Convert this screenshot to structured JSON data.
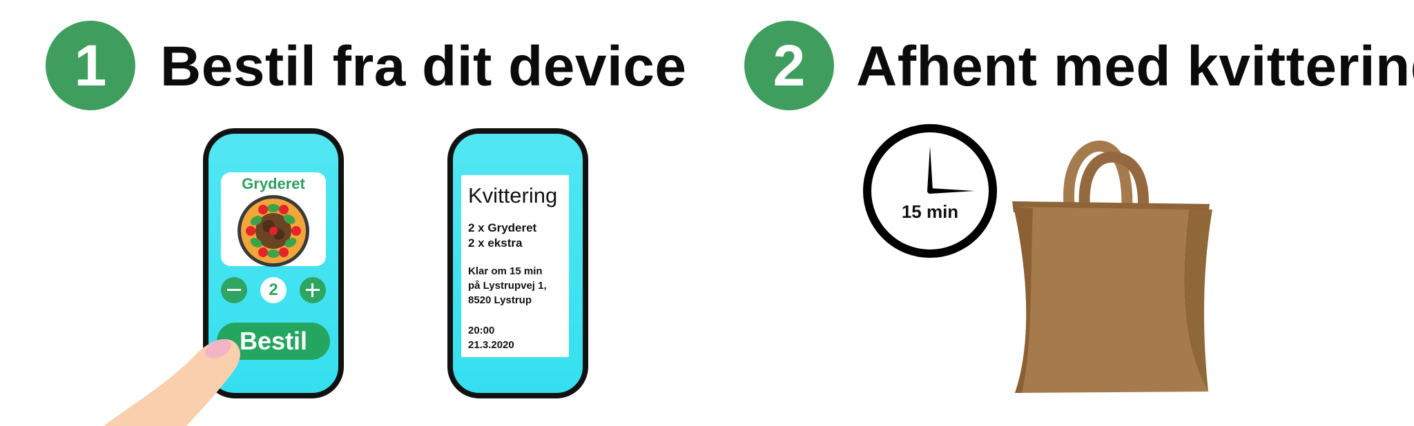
{
  "steps": [
    {
      "number": "1",
      "title": "Bestil fra dit device"
    },
    {
      "number": "2",
      "title": "Afhent med kvittering"
    }
  ],
  "order_phone": {
    "dish_name": "Gryderet",
    "quantity": "2",
    "order_button": "Bestil"
  },
  "receipt_phone": {
    "title": "Kvittering",
    "items": [
      "2 x Gryderet",
      "2 x ekstra"
    ],
    "pickup_lines": [
      "Klar om 15 min",
      "på Lystrupvej 1,",
      "8520 Lystrup"
    ],
    "time": "20:00",
    "date": "21.3.2020"
  },
  "clock": {
    "label": "15 min"
  },
  "colors": {
    "step_green": "#3f9e5d",
    "phone_screen": "#3ee1f1",
    "button_green": "#25a660",
    "bag_brown": "#a57b4e"
  }
}
